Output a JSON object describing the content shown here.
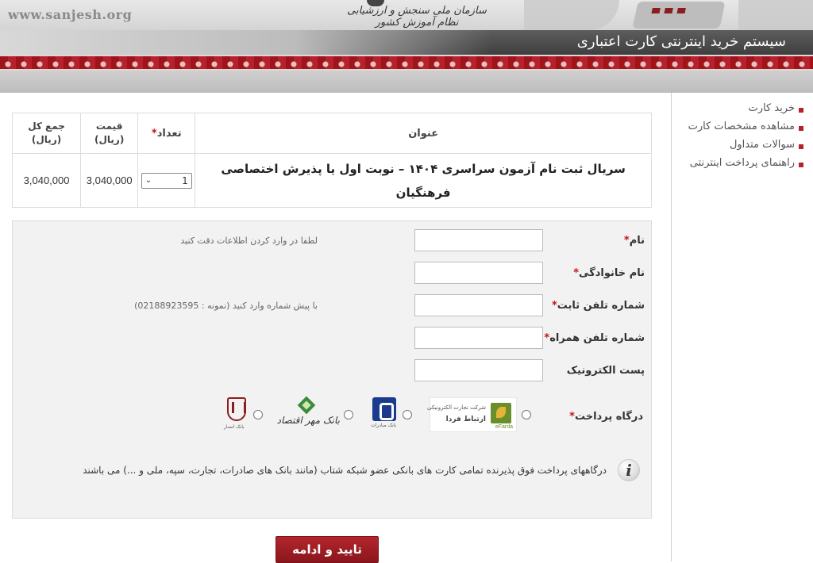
{
  "header": {
    "site_url": "www.sanjesh.org",
    "org_name": "سازمان ملی سنجش و ارزشیابی نظام آموزش کشور",
    "system_title": "سیستم خرید اینترنتی کارت اعتباری"
  },
  "sidebar": {
    "items": [
      {
        "label": "خرید کارت"
      },
      {
        "label": "مشاهده مشخصات کارت"
      },
      {
        "label": "سوالات متداول"
      },
      {
        "label": "راهنمای پرداخت اینترنتی"
      }
    ]
  },
  "order_table": {
    "headers": {
      "title": "عنوان",
      "qty_mark": "*",
      "qty": "تعداد",
      "price": "قیمت",
      "price_unit": "(ریال)",
      "total": "جمع کل",
      "total_unit": "(ریال)"
    },
    "row": {
      "title": "سریال ثبت نام آزمون سراسری ۱۴۰۴ – نوبت اول یا پذیرش اختصاصی فرهنگیان",
      "qty_value": "1",
      "price": "3,040,000",
      "total": "3,040,000"
    }
  },
  "form": {
    "required_mark": "*",
    "fields": [
      {
        "label": "نام",
        "required": true,
        "value": "",
        "hint": "لطفا در وارد کردن اطلاعات دقت کنید"
      },
      {
        "label": "نام خانوادگی",
        "required": true,
        "value": "",
        "hint": ""
      },
      {
        "label": "شماره تلفن ثابت",
        "required": true,
        "value": "",
        "hint": "با پیش شماره وارد کنید (نمونه : 02188923595)"
      },
      {
        "label": "شماره تلفن همراه",
        "required": true,
        "value": "",
        "hint": ""
      },
      {
        "label": "پست الکترونیک",
        "required": false,
        "value": "",
        "hint": ""
      }
    ],
    "gateway": {
      "label": "درگاه پرداخت",
      "options": [
        {
          "name": "efarda",
          "text1": "شرکت تجارت الکترونیکی",
          "text2": "ارتباط فردا",
          "text3": "eFarda",
          "color": "#6a8f2a"
        },
        {
          "name": "saderat",
          "caption": "بانک صادرات",
          "color": "#1b3b8f"
        },
        {
          "name": "mehr",
          "text": "بانک مهر اقتصاد",
          "color": "#3b8a3e"
        },
        {
          "name": "ansar",
          "caption": "بانک انصار",
          "color": "#8b1e1e"
        }
      ]
    },
    "note": "درگاههای پرداخت فوق پذیرنده تمامی کارت های بانکی عضو شبکه شتاب (مانند بانک های صادرات، تجارت، سپه، ملی و ...) می باشند"
  },
  "submit": {
    "label": "تایید و ادامه"
  },
  "colors": {
    "accent": "#b7222a",
    "title_bar": "#4a4a4a",
    "panel": "#f2f2f2"
  }
}
